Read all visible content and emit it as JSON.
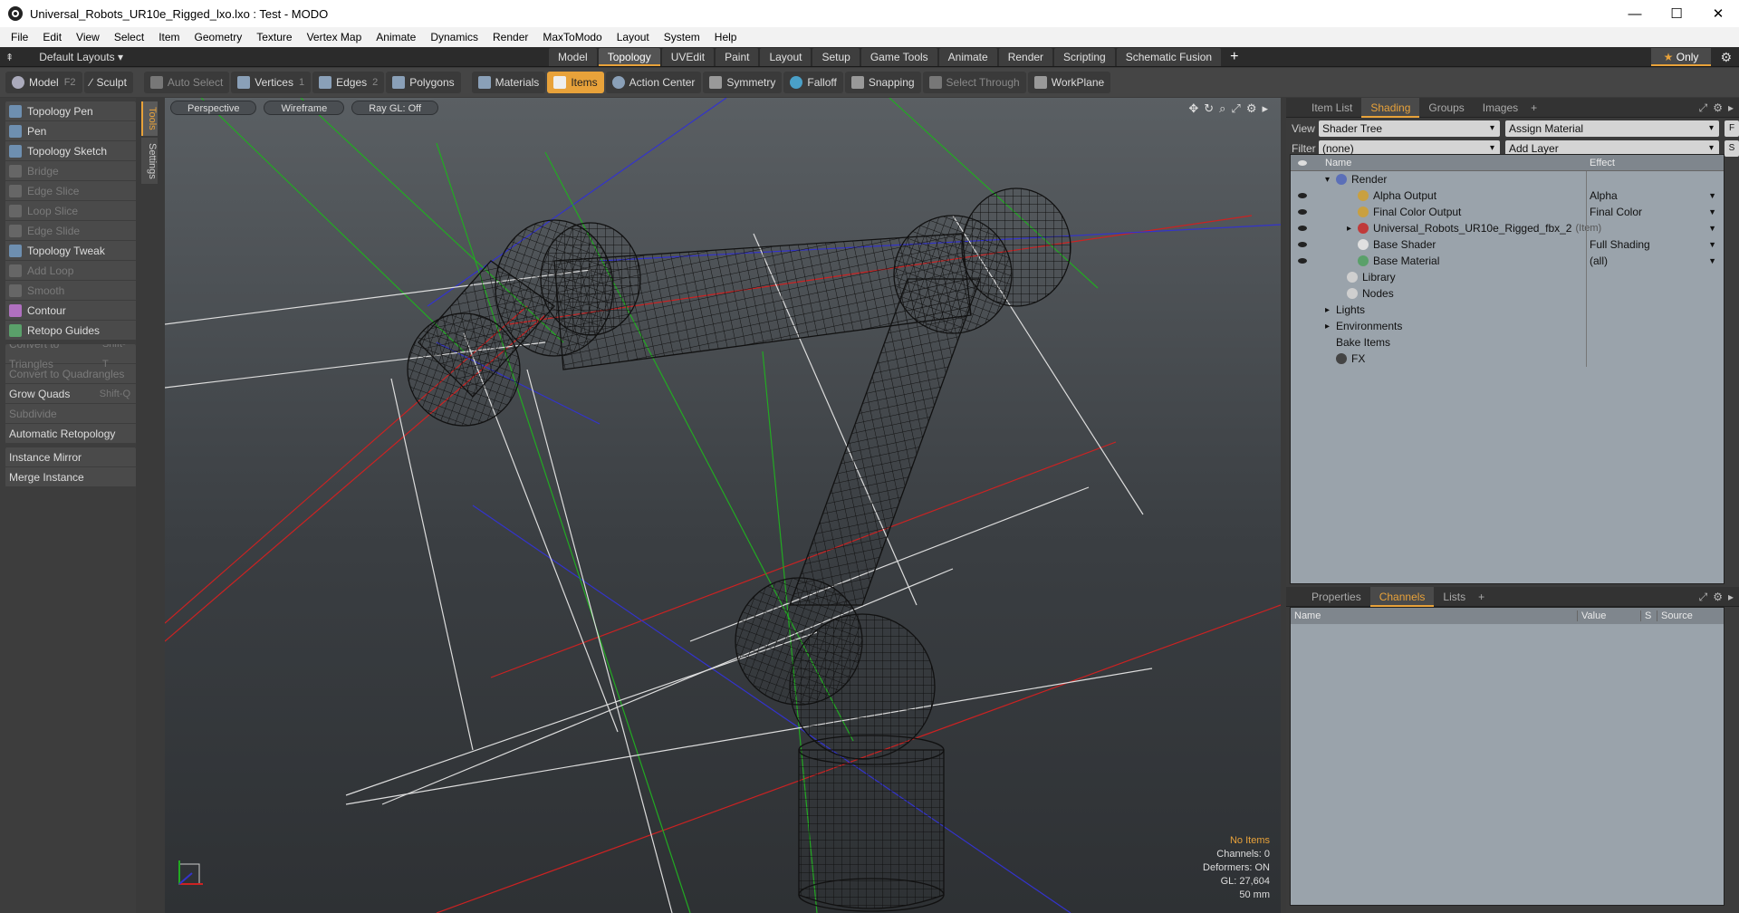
{
  "window": {
    "title": "Universal_Robots_UR10e_Rigged_lxo.lxo : Test - MODO"
  },
  "menu": [
    "File",
    "Edit",
    "View",
    "Select",
    "Item",
    "Geometry",
    "Texture",
    "Vertex Map",
    "Animate",
    "Dynamics",
    "Render",
    "MaxToModo",
    "Layout",
    "System",
    "Help"
  ],
  "layoutbar": {
    "layouts_label": "Default Layouts",
    "tabs": [
      "Model",
      "Topology",
      "UVEdit",
      "Paint",
      "Layout",
      "Setup",
      "Game Tools",
      "Animate",
      "Render",
      "Scripting",
      "Schematic Fusion"
    ],
    "active_tab": "Topology",
    "only_label": "Only"
  },
  "toolbar": {
    "model": "Model",
    "model_key": "F2",
    "sculpt": "Sculpt",
    "auto_select": "Auto Select",
    "vertices": "Vertices",
    "vertices_key": "1",
    "edges": "Edges",
    "edges_key": "2",
    "polygons": "Polygons",
    "materials": "Materials",
    "items": "Items",
    "action_center": "Action Center",
    "symmetry": "Symmetry",
    "falloff": "Falloff",
    "snapping": "Snapping",
    "select_through": "Select Through",
    "workplane": "WorkPlane"
  },
  "lefttools": {
    "group1": [
      {
        "label": "Topology Pen",
        "dim": false
      },
      {
        "label": "Pen",
        "dim": false
      },
      {
        "label": "Topology Sketch",
        "dim": false
      },
      {
        "label": "Bridge",
        "dim": true
      },
      {
        "label": "Edge Slice",
        "dim": true
      },
      {
        "label": "Loop Slice",
        "dim": true
      },
      {
        "label": "Edge Slide",
        "dim": true
      },
      {
        "label": "Topology Tweak",
        "dim": false
      },
      {
        "label": "Add Loop",
        "dim": true
      },
      {
        "label": "Smooth",
        "dim": true
      },
      {
        "label": "Contour",
        "dim": false
      },
      {
        "label": "Retopo Guides",
        "dim": false
      }
    ],
    "group2": [
      {
        "label": "Convert to Triangles",
        "shortcut": "Shift-T",
        "dim": true
      },
      {
        "label": "Convert to Quadrangles",
        "shortcut": "",
        "dim": true
      },
      {
        "label": "Grow Quads",
        "shortcut": "Shift-Q",
        "dim": false
      },
      {
        "label": "Subdivide",
        "shortcut": "",
        "dim": true
      },
      {
        "label": "Automatic Retopology",
        "shortcut": "",
        "dim": false
      }
    ],
    "group3": [
      {
        "label": "Instance Mirror"
      },
      {
        "label": "Merge Instance"
      }
    ],
    "sidetabs": [
      "Tools",
      "Settings"
    ]
  },
  "viewport": {
    "tabs": [
      "Perspective",
      "Wireframe",
      "Ray GL: Off"
    ],
    "info": {
      "no_items": "No Items",
      "channels": "Channels: 0",
      "deformers": "Deformers: ON",
      "gl": "GL: 27,604",
      "scale": "50 mm"
    }
  },
  "shading_panel": {
    "tabs": [
      "Item List",
      "Shading",
      "Groups",
      "Images"
    ],
    "active_tab": "Shading",
    "view_label": "View",
    "view_value": "Shader Tree",
    "assign_material": "Assign Material",
    "filter_label": "Filter",
    "filter_value": "(none)",
    "add_layer": "Add Layer",
    "col_name": "Name",
    "col_effect": "Effect",
    "tree": [
      {
        "name": "Render",
        "effect": "",
        "indent": 1,
        "arrow": "▾",
        "eye": false,
        "icon": "#5b6fb8"
      },
      {
        "name": "Alpha Output",
        "effect": "Alpha",
        "indent": 3,
        "arrow": "",
        "eye": true,
        "icon": "#c9a040"
      },
      {
        "name": "Final Color Output",
        "effect": "Final Color",
        "indent": 3,
        "arrow": "",
        "eye": true,
        "icon": "#c9a040"
      },
      {
        "name": "Universal_Robots_UR10e_Rigged_fbx_2",
        "tag": "(Item)",
        "effect": "",
        "indent": 3,
        "arrow": "▸",
        "eye": true,
        "icon": "#c03a3a"
      },
      {
        "name": "Base Shader",
        "effect": "Full Shading",
        "indent": 3,
        "arrow": "",
        "eye": true,
        "icon": "#e0e0e0"
      },
      {
        "name": "Base Material",
        "effect": "(all)",
        "indent": 3,
        "arrow": "",
        "eye": true,
        "icon": "#5aa06a"
      },
      {
        "name": "Library",
        "effect": "",
        "indent": 2,
        "arrow": "",
        "eye": false,
        "icon": "#cfcfcf"
      },
      {
        "name": "Nodes",
        "effect": "",
        "indent": 2,
        "arrow": "",
        "eye": false,
        "icon": "#cfcfcf"
      },
      {
        "name": "Lights",
        "effect": "",
        "indent": 1,
        "arrow": "▸",
        "eye": false,
        "icon": ""
      },
      {
        "name": "Environments",
        "effect": "",
        "indent": 1,
        "arrow": "▸",
        "eye": false,
        "icon": ""
      },
      {
        "name": "Bake Items",
        "effect": "",
        "indent": 1,
        "arrow": "",
        "eye": false,
        "icon": ""
      },
      {
        "name": "FX",
        "effect": "",
        "indent": 1,
        "arrow": "",
        "eye": false,
        "icon": "#444"
      }
    ]
  },
  "channels_panel": {
    "tabs": [
      "Properties",
      "Channels",
      "Lists"
    ],
    "active_tab": "Channels",
    "cols": [
      "Name",
      "Value",
      "S",
      "Source"
    ]
  }
}
